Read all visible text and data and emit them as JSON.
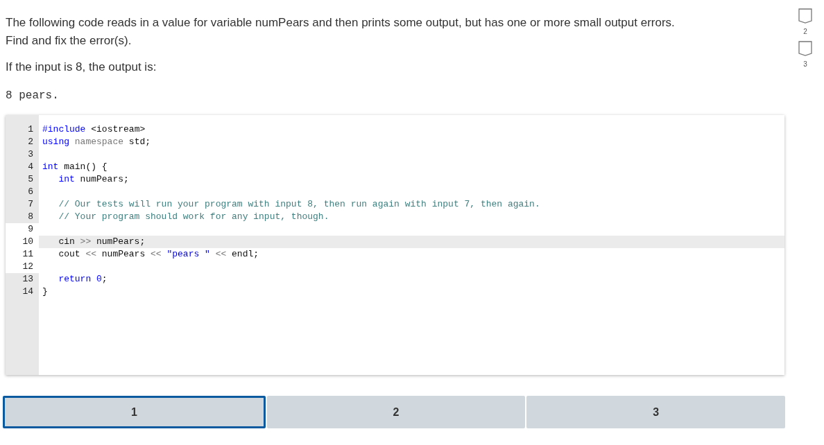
{
  "prompt": {
    "paragraphs": [
      "The following code reads in a value for variable numPears and then prints some output, but has one or more small output errors. Find and fix the error(s).",
      "If the input is 8, the output is:"
    ],
    "sample_output": "8 pears."
  },
  "editor": {
    "lines": [
      {
        "number": "1",
        "gutter_highlight": false,
        "active": false,
        "tokens": [
          {
            "kind": "keyword",
            "text": "#include"
          },
          {
            "kind": "plain",
            "text": " <iostream>"
          }
        ]
      },
      {
        "number": "2",
        "gutter_highlight": false,
        "active": false,
        "tokens": [
          {
            "kind": "keyword",
            "text": "using"
          },
          {
            "kind": "muted",
            "text": " namespace"
          },
          {
            "kind": "plain",
            "text": " std;"
          }
        ]
      },
      {
        "number": "3",
        "gutter_highlight": false,
        "active": false
      },
      {
        "number": "4",
        "gutter_highlight": false,
        "active": false,
        "tokens": [
          {
            "kind": "keyword",
            "text": "int"
          },
          {
            "kind": "plain",
            "text": " main() {"
          }
        ]
      },
      {
        "number": "5",
        "gutter_highlight": false,
        "active": false,
        "indented": true,
        "tokens": [
          {
            "kind": "keyword",
            "text": "int"
          },
          {
            "kind": "plain",
            "text": " numPears;"
          }
        ]
      },
      {
        "number": "6",
        "gutter_highlight": false,
        "active": false
      },
      {
        "number": "7",
        "gutter_highlight": false,
        "active": false,
        "indented": true,
        "tokens": [
          {
            "kind": "comment",
            "text": "// Our tests will run your program with input 8, then run again with input 7, then again."
          }
        ]
      },
      {
        "number": "8",
        "gutter_highlight": false,
        "active": false,
        "indented": true,
        "tokens": [
          {
            "kind": "comment",
            "text": "// Your program should work for any input, though."
          }
        ]
      },
      {
        "number": "9",
        "gutter_highlight": true,
        "active": false
      },
      {
        "number": "10",
        "gutter_highlight": true,
        "active": true,
        "indented": true,
        "tokens": [
          {
            "kind": "plain",
            "text": "cin"
          },
          {
            "kind": "muted",
            "text": " >>"
          },
          {
            "kind": "plain",
            "text": " numPears;"
          }
        ]
      },
      {
        "number": "11",
        "gutter_highlight": true,
        "active": false,
        "indented": true,
        "tokens": [
          {
            "kind": "plain",
            "text": "cout"
          },
          {
            "kind": "muted",
            "text": " <<"
          },
          {
            "kind": "plain",
            "text": " numPears"
          },
          {
            "kind": "muted",
            "text": " <<"
          },
          {
            "kind": "string",
            "text": " \"pears \""
          },
          {
            "kind": "muted",
            "text": " <<"
          },
          {
            "kind": "plain",
            "text": " endl;"
          }
        ]
      },
      {
        "number": "12",
        "gutter_highlight": true,
        "active": false
      },
      {
        "number": "13",
        "gutter_highlight": false,
        "active": false,
        "indented": true,
        "tokens": [
          {
            "kind": "keyword",
            "text": "return"
          },
          {
            "kind": "number",
            "text": " 0"
          },
          {
            "kind": "plain",
            "text": ";"
          }
        ]
      },
      {
        "number": "14",
        "gutter_highlight": false,
        "active": false,
        "tokens": [
          {
            "kind": "plain",
            "text": "}"
          }
        ]
      }
    ]
  },
  "steps": [
    {
      "label": "1",
      "selected": true
    },
    {
      "label": "2",
      "selected": false
    },
    {
      "label": "3",
      "selected": false
    }
  ],
  "side_markers": [
    {
      "label": "2"
    },
    {
      "label": "3"
    }
  ]
}
